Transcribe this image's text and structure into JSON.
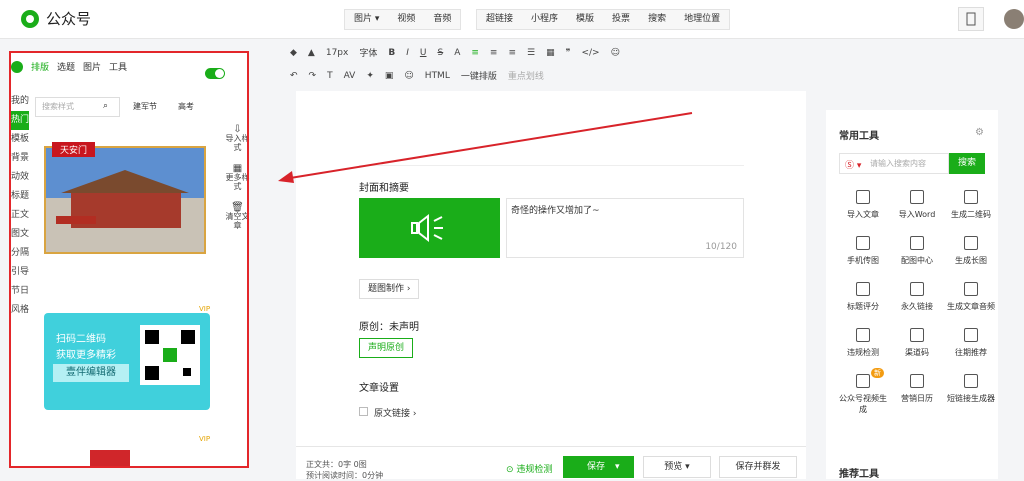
{
  "app": {
    "title": "公众号"
  },
  "topbar": {
    "insert_group1": [
      "图片 ▾",
      "视频",
      "音频"
    ],
    "insert_group2": [
      "超链接",
      "小程序",
      "模版",
      "投票",
      "搜索",
      "地理位置"
    ]
  },
  "toolbar": {
    "font_size": "17px",
    "font_label": "字体",
    "row1": [
      "B",
      "I",
      "U",
      "S",
      "A"
    ],
    "onekey": "一键排版",
    "highlight": "重点划线"
  },
  "left_panel": {
    "tabs": [
      "排版",
      "选题",
      "图片",
      "工具"
    ],
    "categories": [
      "我的",
      "热门",
      "模板",
      "背景",
      "动效",
      "标题",
      "正文",
      "图文",
      "分隔",
      "引导",
      "节日",
      "风格"
    ],
    "search_placeholder": "搜索样式",
    "tags": [
      "建军节",
      "高考"
    ],
    "tpl1_label": "天安门",
    "tpl2_text1": "扫码二维码",
    "tpl2_text2": "获取更多精彩",
    "tpl2_button": "壹伴编辑器",
    "vip": "VIP",
    "side_tools": [
      "导入样式",
      "更多样式",
      "清空文章"
    ]
  },
  "editor": {
    "cover_title": "封面和摘要",
    "summary_text": "奇怪的操作又增加了~",
    "summary_count": "10/120",
    "cover_make": "题图制作 ›",
    "original_label": "原创：未声明",
    "declare_button": "声明原创",
    "settings_title": "文章设置",
    "original_link": "原文链接 ›"
  },
  "bottom": {
    "word_count": "正文共：0字 0图",
    "read_time": "预计阅读时间：0分钟",
    "check": "违规检测",
    "save": "保存",
    "preview": "预览",
    "save_send": "保存并群发"
  },
  "right_panel": {
    "title": "常用工具",
    "search_placeholder": "请输入搜索内容",
    "search_button": "搜索",
    "tools": [
      "导入文章",
      "导入Word",
      "生成二维码",
      "手机传图",
      "配图中心",
      "生成长图",
      "标题评分",
      "永久链接",
      "生成文章音频",
      "违规检测",
      "渠道码",
      "往期推荐",
      "公众号视频生成",
      "营销日历",
      "短链接生成器"
    ],
    "new_badge": "新",
    "recommend_title": "推荐工具"
  }
}
